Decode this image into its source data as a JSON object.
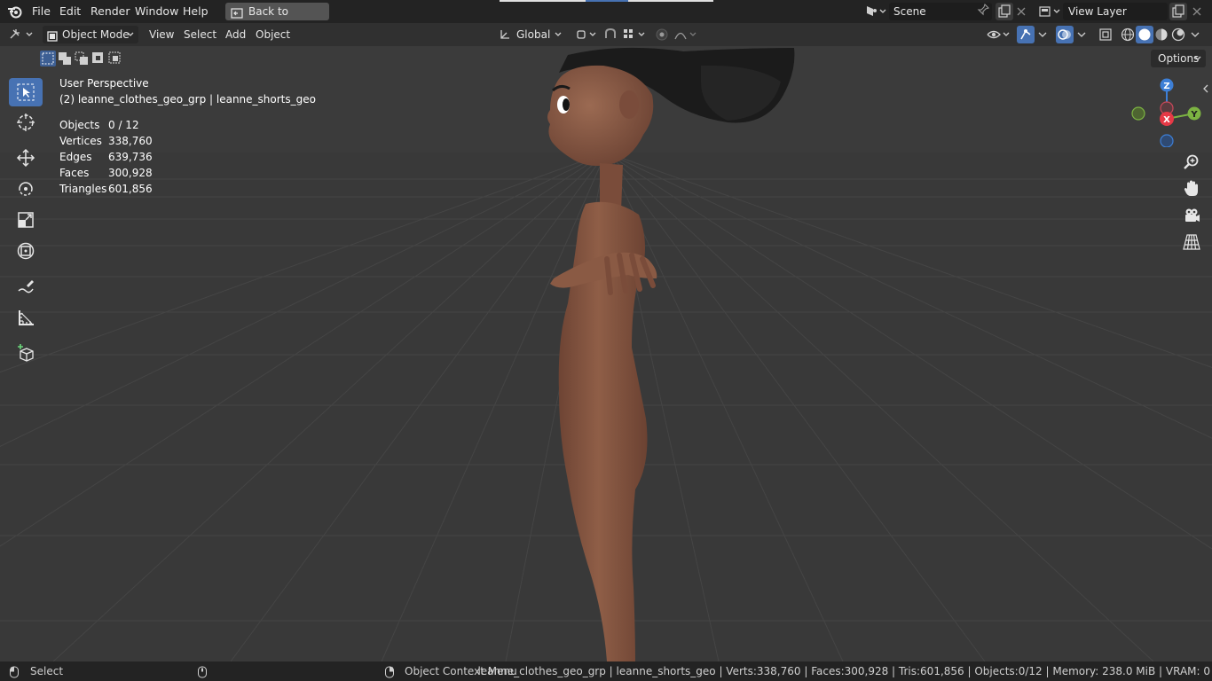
{
  "topbar": {
    "menus": [
      "File",
      "Edit",
      "Render",
      "Window",
      "Help"
    ],
    "back_label": "Back to Previous",
    "scene": "Scene",
    "view_layer": "View Layer"
  },
  "header": {
    "mode": "Object Mode",
    "menus": [
      "View",
      "Select",
      "Add",
      "Object"
    ],
    "orientation": "Global",
    "options_label": "Options"
  },
  "overlay": {
    "perspective": "User Perspective",
    "active_object": "(2) leanne_clothes_geo_grp | leanne_shorts_geo",
    "stats": [
      {
        "label": "Objects",
        "value": "0 / 12"
      },
      {
        "label": "Vertices",
        "value": "338,760"
      },
      {
        "label": "Edges",
        "value": "639,736"
      },
      {
        "label": "Faces",
        "value": "300,928"
      },
      {
        "label": "Triangles",
        "value": "601,856"
      }
    ]
  },
  "gizmo": {
    "x": "X",
    "y": "Y",
    "z": "Z"
  },
  "statusbar": {
    "left_action": "Select",
    "middle_action": "Object Context Menu",
    "right_info": "leanne_clothes_geo_grp | leanne_shorts_geo | Verts:338,760 | Faces:300,928 | Tris:601,856 | Objects:0/12 | Memory: 238.0 MiB | VRAM: 0"
  },
  "colors": {
    "accent": "#4772b3",
    "axis_x": "#e63946",
    "axis_y": "#7cb342",
    "axis_z": "#3d7fd6",
    "skin": "#8a5a44"
  }
}
